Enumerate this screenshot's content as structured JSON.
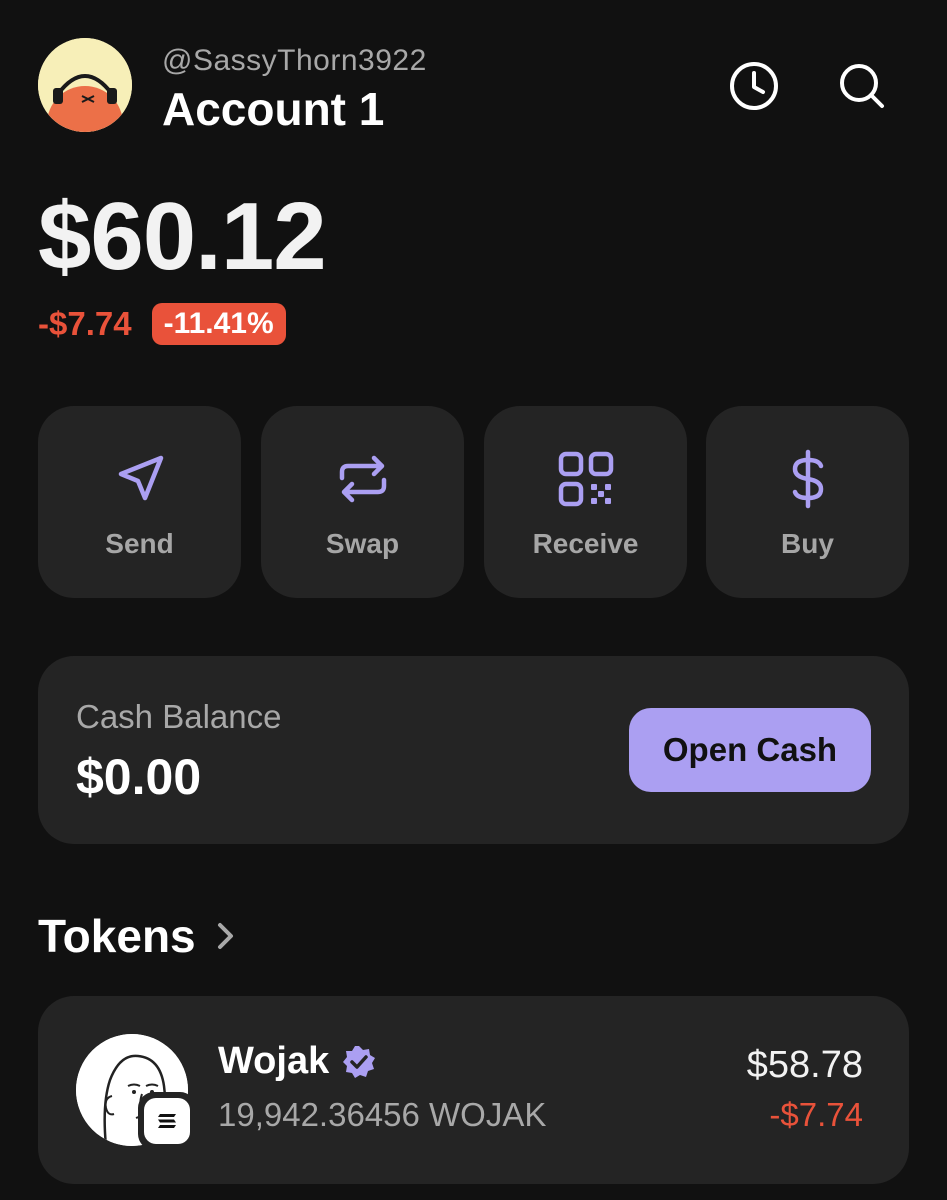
{
  "header": {
    "username": "@SassyThorn3922",
    "account_name": "Account 1",
    "icons": [
      "history-icon",
      "search-icon"
    ]
  },
  "portfolio": {
    "balance": "$60.12",
    "change_abs": "-$7.74",
    "change_pct": "-11.41%"
  },
  "actions": [
    {
      "label": "Send",
      "icon": "send-icon"
    },
    {
      "label": "Swap",
      "icon": "swap-icon"
    },
    {
      "label": "Receive",
      "icon": "qr-code-icon"
    },
    {
      "label": "Buy",
      "icon": "dollar-icon"
    }
  ],
  "cash": {
    "label": "Cash Balance",
    "value": "$0.00",
    "button_label": "Open Cash"
  },
  "tokens": {
    "title": "Tokens",
    "items": [
      {
        "name": "Wojak",
        "amount": "19,942.36456 WOJAK",
        "value": "$58.78",
        "change": "-$7.74",
        "verified": true
      }
    ]
  },
  "colors": {
    "background": "#111111",
    "card": "#242424",
    "accent": "#ab9ff2",
    "negative": "#e9523a",
    "muted_text": "#a8a8a8"
  }
}
